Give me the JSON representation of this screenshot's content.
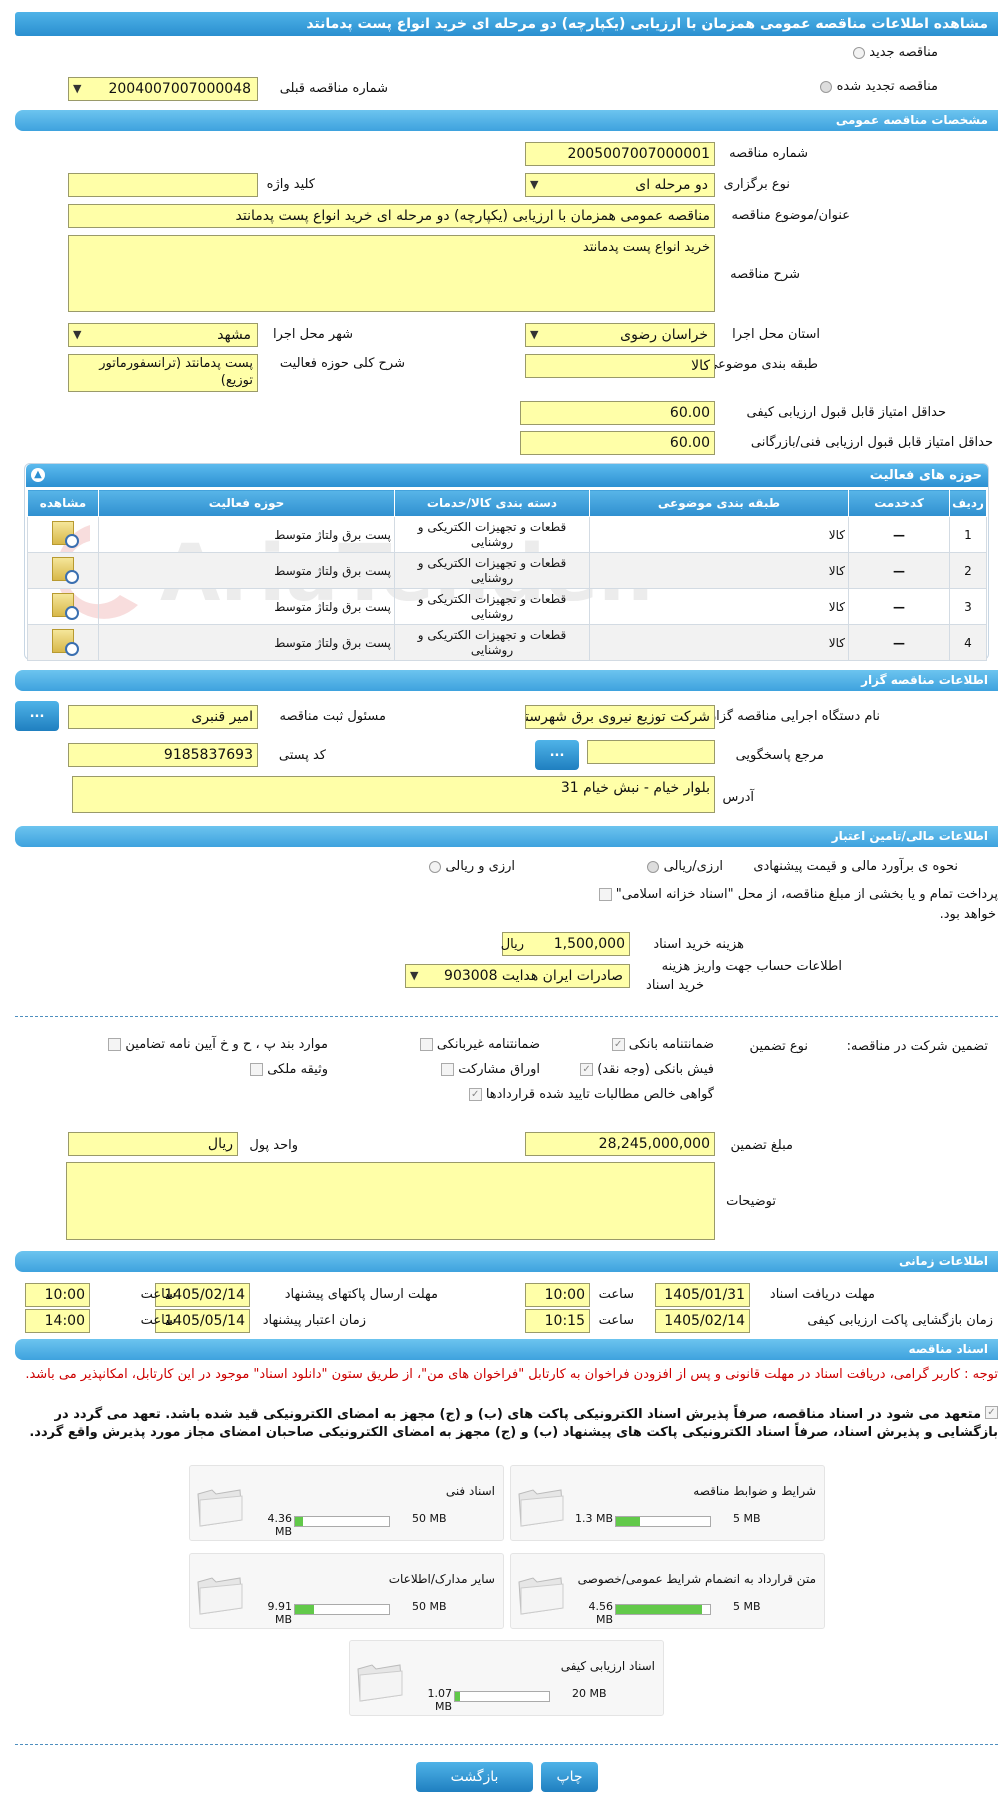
{
  "page_title": "مشاهده اطلاعات مناقصه عمومی همزمان با ارزیابی (یکپارچه) دو مرحله ای خرید انواع پست پدمانتد",
  "mode": {
    "new_label": "مناقصه جدید",
    "renewed_label": "مناقصه تجدید شده",
    "prev_number_label": "شماره مناقصه قبلی",
    "prev_number_value": "2004007007000048"
  },
  "general": {
    "header": "مشخصات مناقصه عمومی",
    "number_label": "شماره مناقصه",
    "number_value": "2005007007000001",
    "type_label": "نوع برگزاری",
    "type_value": "دو مرحله ای",
    "keyword_label": "کلید واژه",
    "keyword_value": "",
    "subject_label": "عنوان/موضوع مناقصه",
    "subject_value": "مناقصه عمومی همزمان با ارزیابی (یکپارچه) دو مرحله ای خرید انواع پست پدمانتد",
    "desc_label": "شرح مناقصه",
    "desc_value": "خرید انواع پست پدمانتد",
    "province_label": "استان محل اجرا",
    "province_value": "خراسان رضوی",
    "city_label": "شهر محل اجرا",
    "city_value": "مشهد",
    "category_label": "طبقه بندی موضوعی",
    "category_value": "کالا",
    "activity_desc_label": "شرح کلی حوزه فعالیت",
    "activity_desc_value": "پست پدمانتد (ترانسفورماتور توزیع)",
    "min_quality_label": "حداقل امتیاز قابل قبول ارزیابی کیفی",
    "min_quality_value": "60.00",
    "min_tech_label": "حداقل امتیاز قابل قبول ارزیابی فنی/بازرگانی",
    "min_tech_value": "60.00"
  },
  "activities": {
    "header": "حوزه های فعالیت",
    "columns": [
      "ردیف",
      "کدخدمت",
      "طبقه بندی موضوعی",
      "دسته بندی کالا/خدمات",
      "حوزه فعالیت",
      "مشاهده"
    ],
    "rows": [
      {
        "row": "1",
        "code": "—",
        "category": "کالا",
        "group": "قطعات و تجهیزات الکتریکی و روشنایی",
        "field": "پست برق ولتاژ متوسط"
      },
      {
        "row": "2",
        "code": "—",
        "category": "کالا",
        "group": "قطعات و تجهیزات الکتریکی و روشنایی",
        "field": "پست برق ولتاژ متوسط"
      },
      {
        "row": "3",
        "code": "—",
        "category": "کالا",
        "group": "قطعات و تجهیزات الکتریکی و روشنایی",
        "field": "پست برق ولتاژ متوسط"
      },
      {
        "row": "4",
        "code": "—",
        "category": "کالا",
        "group": "قطعات و تجهیزات الکتریکی و روشنایی",
        "field": "پست برق ولتاژ متوسط"
      }
    ]
  },
  "organizer": {
    "header": "اطلاعات مناقصه گزار",
    "org_label": "نام دستگاه اجرایی مناقصه گزار",
    "org_value": "شرکت توزیع نیروی برق شهرستان مشهد",
    "registrar_label": "مسئول ثبت مناقصه",
    "registrar_value": "امیر قنبری",
    "more_button": "...",
    "ref_label": "مرجع پاسخگویی",
    "ref_value": "",
    "postal_label": "کد پستی",
    "postal_value": "9185837693",
    "address_label": "آدرس",
    "address_value": "بلوار خیام - نبش خیام 31"
  },
  "finance": {
    "header": "اطلاعات مالی/تامین اعتبار",
    "estimate_label": "نحوه ی برآورد مالی و قیمت پیشنهادی",
    "opt_rial": "ارزی/ریالی",
    "opt_fx": "ارزی و ریالی",
    "treasury_text_1": "پرداخت تمام و یا بخشی از مبلغ مناقصه، از محل \"اسناد خزانه اسلامی\"",
    "treasury_text_2": "خواهد بود.",
    "doc_cost_label": "هزینه خرید اسناد",
    "doc_cost_value": "1,500,000",
    "doc_cost_unit": "ریال",
    "account_label_1": "اطلاعات حساب جهت واریز هزینه",
    "account_label_2": "خرید اسناد",
    "account_value": "صادرات ایران هدایت 903008"
  },
  "guarantee": {
    "section_label": "تضمین شرکت در مناقصه:",
    "type_label": "نوع تضمین",
    "options": {
      "bank_guarantee": "ضمانتنامه بانکی",
      "nonbank_guarantee": "ضمانتنامه غیربانکی",
      "clauses": "موارد بند پ ، ح و خ آیین نامه تضامین",
      "bank_receipt": "فیش بانکی (وجه نقد)",
      "bonds": "اوراق مشارکت",
      "property": "وثیقه ملکی",
      "receivables": "گواهی خالص مطالبات تایید شده قراردادها"
    },
    "amount_label": "مبلغ تضمین",
    "amount_value": "28,245,000,000",
    "currency_label": "واحد پول",
    "currency_value": "ریال",
    "notes_label": "توضیحات",
    "notes_value": ""
  },
  "timing": {
    "header": "اطلاعات زمانی",
    "doc_deadline_label": "مهلت دریافت اسناد",
    "doc_deadline_date": "1405/01/31",
    "doc_deadline_time": "10:00",
    "send_deadline_label": "مهلت ارسال پاکتهای پیشنهاد",
    "send_deadline_date": "1405/02/14",
    "send_deadline_time": "10:00",
    "open_label": "زمان بازگشایی پاکت ارزیابی کیفی",
    "open_date": "1405/02/14",
    "open_time": "10:15",
    "validity_label": "زمان اعتبار پیشنهاد",
    "validity_date": "1405/05/14",
    "validity_time": "14:00",
    "time_word": "ساعت"
  },
  "documents": {
    "header": "اسناد مناقصه",
    "notice": "توجه : کاربر گرامی، دریافت اسناد در مهلت قانونی و پس از افزودن فراخوان به کارتابل \"فراخوان های من\"، از طریق ستون \"دانلود اسناد\" موجود در این کارتابل، امکانپذیر می باشد.",
    "commit_text": "متعهد می شود در اسناد مناقصه، صرفاً پذیرش اسناد الکترونیکی پاکت های (ب) و (ج) مجهز به امضای الکترونیکی قید شده باشد. تعهد می گردد در بازگشایی و پذیرش اسناد، صرفاً اسناد الکترونیکی پاکت های پیشنهاد (ب) و (ج) مجهز به امضای الکترونیکی صاحبان امضای مجاز مورد پذیرش واقع گردد.",
    "files": [
      {
        "name": "شرایط و ضوابط مناقصه",
        "size": "1.3 MB",
        "max": "5 MB",
        "fill": 0.26
      },
      {
        "name": "اسناد فنی",
        "size": "4.36 MB",
        "max": "50 MB",
        "fill": 0.09
      },
      {
        "name": "متن قرارداد به انضمام شرایط عمومی/خصوصی",
        "size": "4.56 MB",
        "max": "5 MB",
        "fill": 0.91
      },
      {
        "name": "سایر مدارک/اطلاعات",
        "size": "9.91 MB",
        "max": "50 MB",
        "fill": 0.2
      },
      {
        "name": "اسناد ارزیابی کیفی",
        "size": "1.07 MB",
        "max": "20 MB",
        "fill": 0.05
      }
    ]
  },
  "footer": {
    "print_button": "چاپ",
    "back_button": "بازگشت"
  },
  "watermark": "AriaTender.neT",
  "colors": {
    "header_blue": "#2a8fd0",
    "input_yellow": "#ffffa8",
    "notice_red": "#cc0000",
    "progress_green": "#62c94a"
  }
}
